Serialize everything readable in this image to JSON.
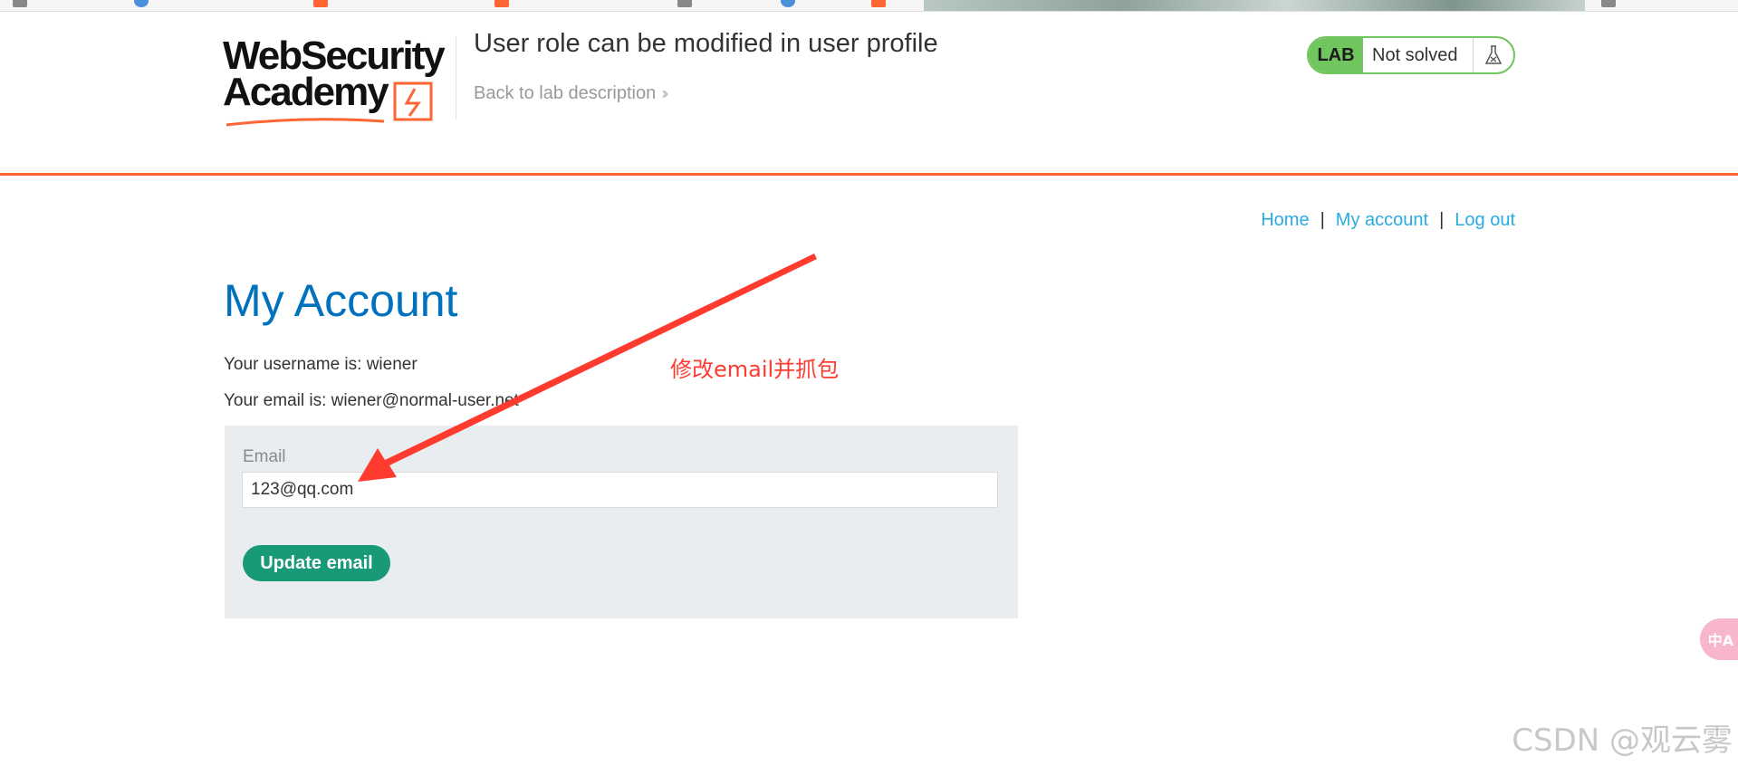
{
  "header": {
    "logo_text_line1": "WebSecurity",
    "logo_text_line2": "Academy",
    "lab_title": "User role can be modified in user profile",
    "back_link": "Back to lab description",
    "lab_badge": "LAB",
    "lab_status": "Not solved",
    "status_color": "#70c55e",
    "accent_color": "#ff6633"
  },
  "nav": {
    "items": [
      {
        "label": "Home"
      },
      {
        "label": "My account"
      },
      {
        "label": "Log out"
      }
    ],
    "separator": "|"
  },
  "main": {
    "heading": "My Account",
    "username_line": "Your username is: wiener",
    "email_line": "Your email is: wiener@normal-user.net",
    "form": {
      "email_label": "Email",
      "email_value": "123@qq.com",
      "submit_label": "Update email"
    }
  },
  "annotation": {
    "text": "修改email并抓包",
    "color": "#ff3b30"
  },
  "translate_button": {
    "label": "中A"
  },
  "watermark": "CSDN @观云雾"
}
